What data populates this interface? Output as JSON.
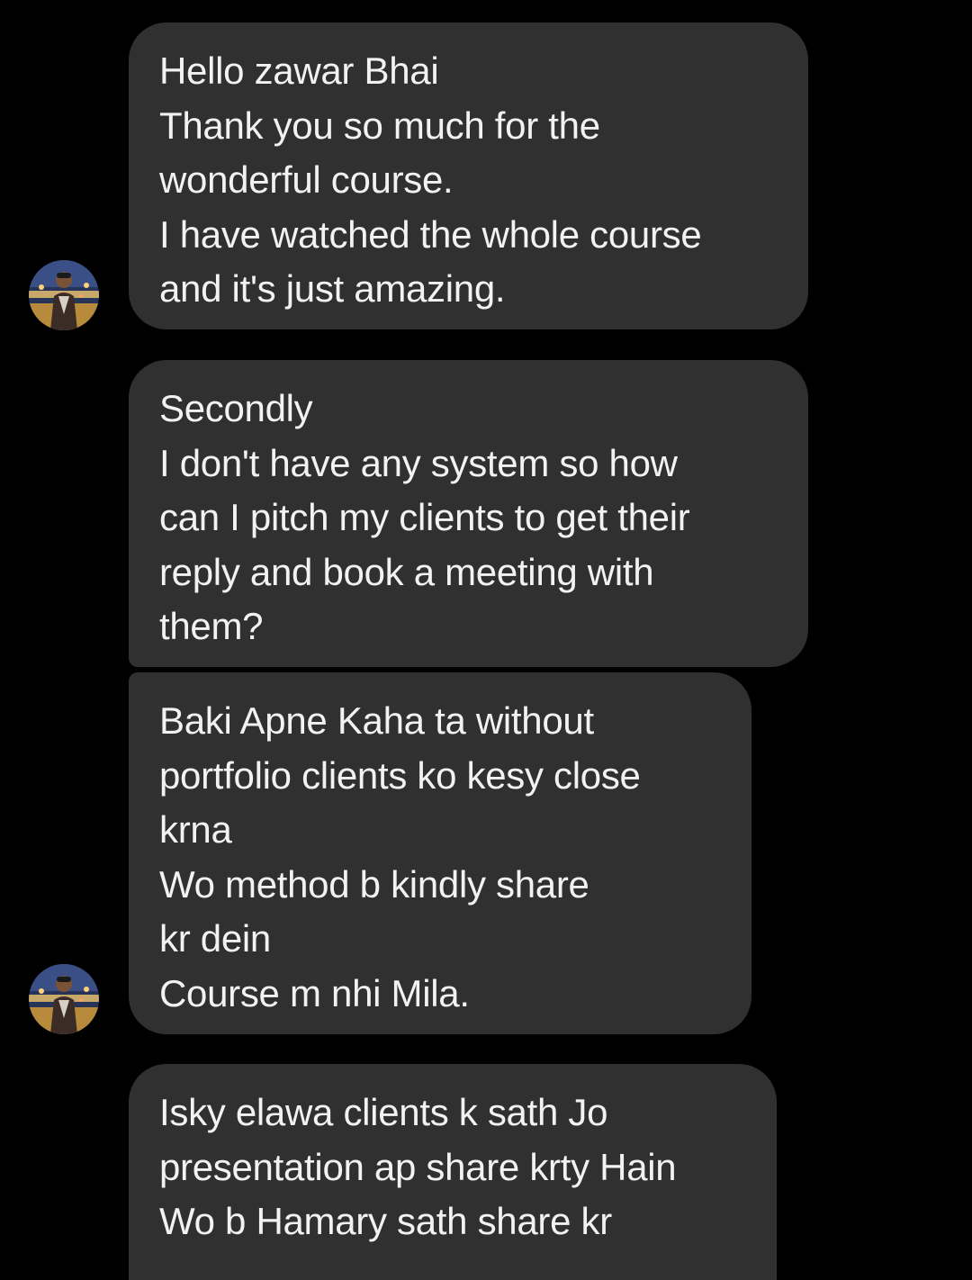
{
  "conversation": {
    "messages": [
      {
        "lines": [
          "Hello zawar Bhai",
          "Thank you so much for the",
          "wonderful course.",
          "I have watched the whole course",
          "and it's just amazing."
        ]
      },
      {
        "lines": [
          "Secondly",
          "I don't have any system so how",
          "can I pitch my clients to get their",
          "reply and book a meeting with",
          "them?"
        ]
      },
      {
        "lines": [
          "Baki Apne Kaha ta without",
          "portfolio clients ko kesy close",
          "krna",
          "Wo method b kindly share",
          "kr dein",
          "Course m nhi Mila."
        ]
      },
      {
        "lines": [
          "Isky elawa clients k sath Jo",
          "presentation ap share krty Hain",
          "Wo b Hamary sath share kr"
        ]
      }
    ]
  },
  "colors": {
    "background": "#000000",
    "bubble": "#303030",
    "text": "#f2f2f2"
  },
  "icons": {
    "avatar": "sender-avatar-icon"
  }
}
